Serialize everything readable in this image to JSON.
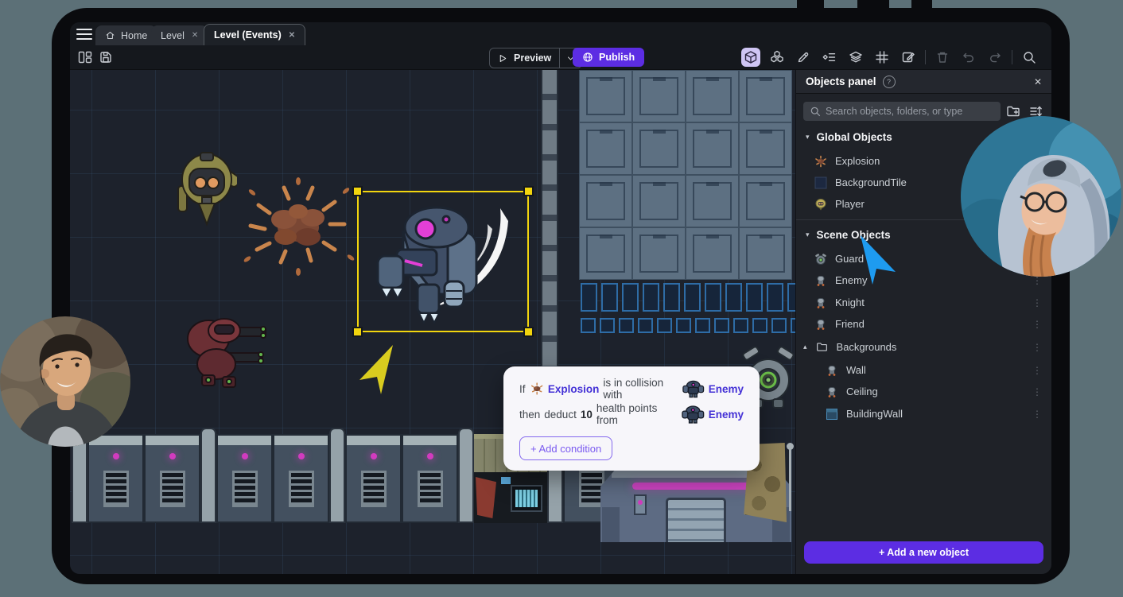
{
  "window": {
    "tabs": [
      {
        "label": "Home"
      },
      {
        "label": "Level"
      },
      {
        "label": "Level (Events)"
      }
    ],
    "toolbar": {
      "preview_label": "Preview",
      "publish_label": "Publish",
      "right_icon_names": [
        "cube",
        "cube-group",
        "pencil",
        "event-sheet",
        "layers",
        "grid",
        "scene-edit",
        "trash",
        "undo",
        "redo",
        "search"
      ]
    }
  },
  "objects_panel": {
    "title": "Objects panel",
    "search_placeholder": "Search objects, folders, or type",
    "sections": [
      {
        "header": "Global Objects",
        "items": [
          "Explosion",
          "BackgroundTile",
          "Player"
        ]
      },
      {
        "header": "Scene Objects",
        "items": [
          "Guard",
          "Enemy",
          "Knight",
          "Friend",
          "Backgrounds",
          "Wall",
          "Ceiling",
          "BuildingWall"
        ]
      }
    ],
    "add_button_label": "+ Add a new object"
  },
  "event_card": {
    "if_label": "If",
    "condition_subject": "Explosion",
    "condition_text": "is in collision with",
    "condition_object": "Enemy",
    "then_label": "then",
    "action_text_1": "deduct",
    "action_value": "10",
    "action_text_2": "health points from",
    "action_object": "Enemy",
    "add_condition_label": "+ Add condition"
  },
  "icons": {
    "close": "✕",
    "help": "?",
    "caret_down": "▾",
    "caret_up": "▴",
    "row_menu": "⋮"
  },
  "colors": {
    "accent_purple": "#5c2de3",
    "link_purple": "#4431d6",
    "selection_yellow": "#f2d50e",
    "cursor_blue": "#1e9bf0",
    "cursor_yellow": "#d9cc1f",
    "magenta": "#d23bbf"
  }
}
